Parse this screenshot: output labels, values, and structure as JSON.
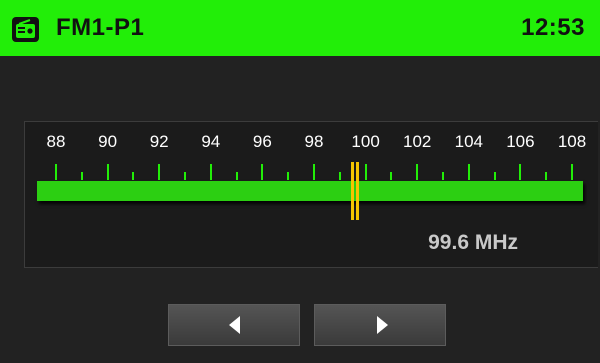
{
  "header": {
    "icon": "radio-icon",
    "station_label": "FM1-P1",
    "time": "12:53"
  },
  "tuner": {
    "scale_labels": [
      "88",
      "90",
      "92",
      "94",
      "96",
      "98",
      "100",
      "102",
      "104",
      "106",
      "108"
    ],
    "min_mhz": 88,
    "max_mhz": 108,
    "current_mhz": 99.6,
    "frequency_text": "99.6 MHz"
  },
  "controls": {
    "seek_back_icon": "triangle-left-icon",
    "seek_forward_icon": "triangle-right-icon"
  },
  "colors": {
    "accent": "#22ee08",
    "band": "#2ccf12",
    "needle": "#f5c400",
    "background": "#222222"
  }
}
